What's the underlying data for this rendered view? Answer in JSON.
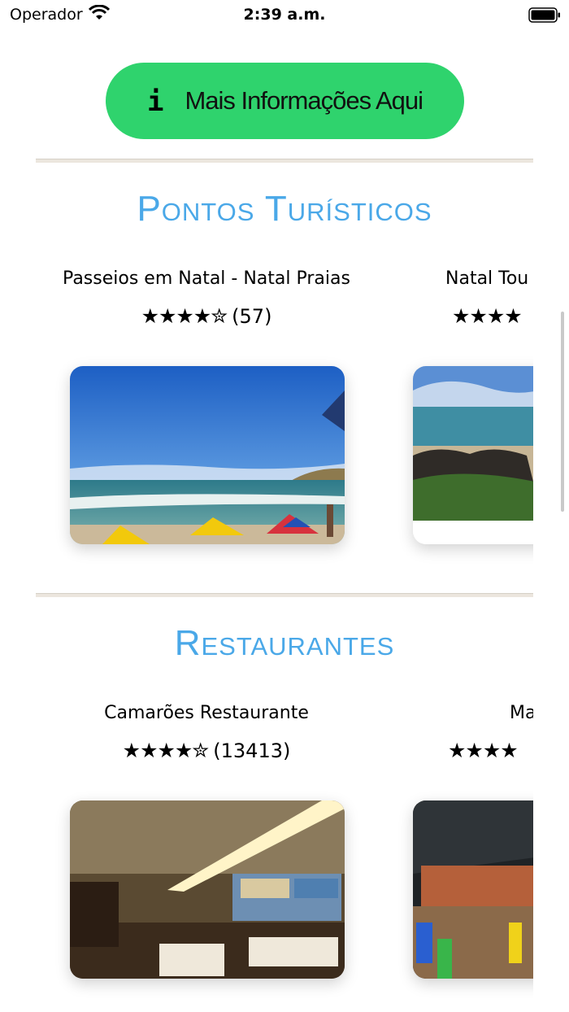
{
  "status_bar": {
    "carrier": "Operador",
    "time": "2:39 a.m."
  },
  "info_button": {
    "icon": "i",
    "label": "Mais Informações Aqui"
  },
  "sections": {
    "tourism": {
      "title": "Pontos Turísticos",
      "cards": [
        {
          "name": "Passeios em Natal - Natal Praias",
          "stars": "★★★★✮",
          "count": "(57)",
          "rating": 4.5
        },
        {
          "name": "Natal Tou",
          "stars": "★★★★",
          "count": "",
          "rating": 4.5
        }
      ]
    },
    "restaurants": {
      "title": "Restaurantes",
      "cards": [
        {
          "name": "Camarões Restaurante",
          "stars": "★★★★✮",
          "count": "(13413)",
          "rating": 4.5
        },
        {
          "name": "Ma",
          "stars": "★★★★",
          "count": "",
          "rating": 4.5
        }
      ]
    }
  },
  "colors": {
    "accent_green": "#2fd36d",
    "section_title_blue": "#4aa8e8",
    "divider": "#ece6de"
  }
}
